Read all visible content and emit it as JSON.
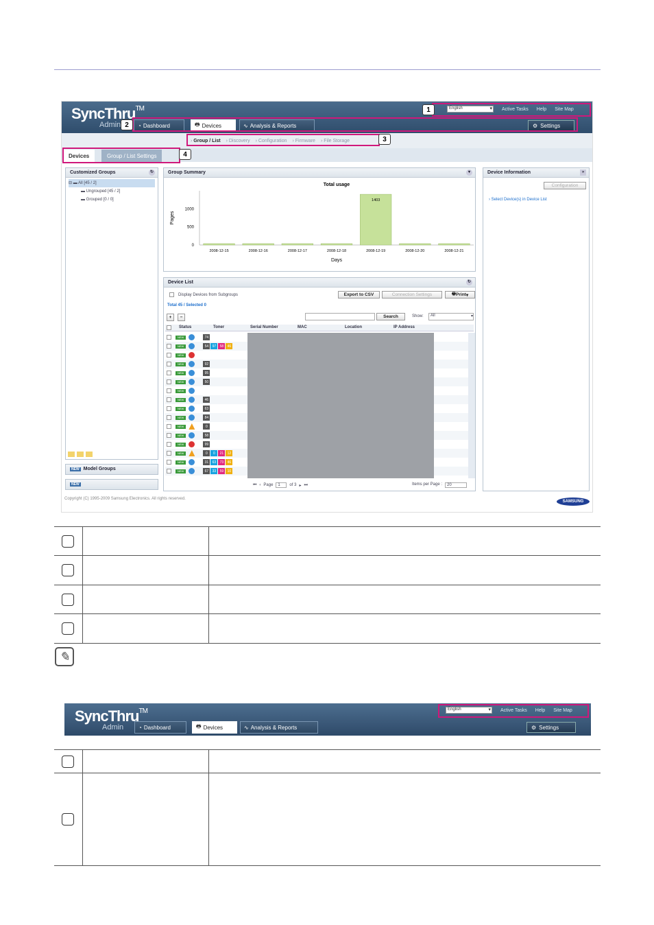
{
  "app": {
    "logo": "SyncThru",
    "logo_tm": "TM",
    "logo_sub": "Admin",
    "language": "English",
    "links": [
      "Active Tasks",
      "Help",
      "Site Map"
    ],
    "tabs": [
      "Dashboard",
      "Devices",
      "Analysis & Reports"
    ],
    "settings": "Settings",
    "subnav": [
      "Group / List",
      "Discovery",
      "Configuration",
      "Firmware",
      "File Storage"
    ],
    "subtabs": [
      "Devices",
      "Group / List Settings"
    ],
    "callouts": [
      "1",
      "2",
      "3",
      "4"
    ]
  },
  "groups": {
    "title": "Customized Groups",
    "all": "All [45 / 2]",
    "ungrouped": "Ungrouped [45 / 2]",
    "grouped": "Grouped [0 / 0]",
    "model_badge": "NEW",
    "model_groups": "Model Groups"
  },
  "summary": {
    "title": "Group Summary"
  },
  "chart_data": {
    "type": "bar",
    "title": "Total usage",
    "xlabel": "Days",
    "ylabel": "Pages",
    "categories": [
      "2008-12-15",
      "2008-12-16",
      "2008-12-17",
      "2008-12-18",
      "2008-12-19",
      "2008-12-20",
      "2008-12-21"
    ],
    "values": [
      0,
      0,
      0,
      0,
      1403,
      0,
      0
    ],
    "data_labels": [
      "",
      "",
      "",
      "",
      "1403",
      "",
      ""
    ],
    "yticks": [
      "0",
      "500",
      "1000"
    ],
    "ylim": [
      0,
      1500
    ],
    "bar_color": "#c6e19a"
  },
  "device_list": {
    "title": "Device List",
    "display_sub": "Display Devices from Subgroups",
    "total": "Total 45 / Selected 0",
    "export": "Export to CSV",
    "conn": "Connection Settings",
    "print": "Print",
    "search": "Search",
    "show_label": "Show:",
    "show_value": "All",
    "columns": [
      "Status",
      "Toner",
      "Serial Number",
      "MAC",
      "Location",
      "IP Address"
    ],
    "rows": [
      {
        "st": "ok",
        "toner": [
          "74"
        ]
      },
      {
        "st": "ok",
        "toner": [
          "54",
          "97",
          "58",
          "46"
        ]
      },
      {
        "st": "err",
        "toner": []
      },
      {
        "st": "ok",
        "toner": [
          "92"
        ]
      },
      {
        "st": "ok",
        "toner": [
          "95"
        ]
      },
      {
        "st": "ok",
        "toner": [
          "50"
        ]
      },
      {
        "st": "ok",
        "toner": []
      },
      {
        "st": "ok",
        "toner": [
          "46"
        ]
      },
      {
        "st": "ok",
        "toner": [
          "63"
        ]
      },
      {
        "st": "ok",
        "toner": [
          "84"
        ]
      },
      {
        "st": "warn",
        "toner": [
          "0"
        ]
      },
      {
        "st": "ok",
        "toner": [
          "58"
        ]
      },
      {
        "st": "err",
        "toner": [
          "99"
        ]
      },
      {
        "st": "warn",
        "toner": [
          "0",
          "0",
          "21",
          "12"
        ]
      },
      {
        "st": "ok",
        "toner": [
          "31",
          "63",
          "73",
          "46"
        ]
      },
      {
        "st": "ok",
        "toner": [
          "67",
          "33",
          "59",
          "10"
        ]
      }
    ],
    "page_label": "Page",
    "page_value": "1",
    "of": "of 3",
    "ipp_label": "Items per Page :",
    "ipp_value": "20"
  },
  "device_info": {
    "title": "Device Information",
    "config": "Configuration",
    "hint": "Select Device(s) in Device List"
  },
  "copyright": "Copyright (C) 1995-2009 Samsung Electronics. All rights reserved.",
  "brand": "SAMSUNG",
  "colors": {
    "accent": "#d0187b",
    "header": "#3a5878",
    "bar": "#c6e19a"
  }
}
